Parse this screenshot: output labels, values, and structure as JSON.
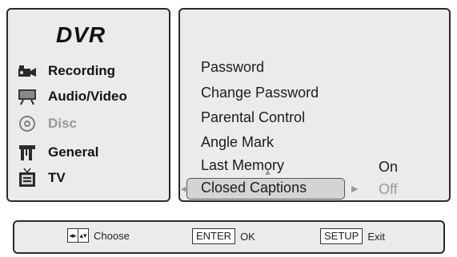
{
  "brand": "DVR",
  "sidebar": {
    "items": [
      {
        "label": "Recording",
        "icon": "camcorder-icon",
        "enabled": true
      },
      {
        "label": "Audio/Video",
        "icon": "monitor-icon",
        "enabled": true
      },
      {
        "label": "Disc",
        "icon": "disc-icon",
        "enabled": false
      },
      {
        "label": "General",
        "icon": "tools-icon",
        "enabled": true
      },
      {
        "label": "TV",
        "icon": "tv-icon",
        "enabled": true
      }
    ]
  },
  "menu": {
    "items": [
      {
        "label": "Password"
      },
      {
        "label": "Change Password"
      },
      {
        "label": "Parental Control"
      },
      {
        "label": "Angle Mark"
      },
      {
        "label": "Last Memory",
        "value": "On"
      },
      {
        "label": "Closed Captions",
        "value": "Off",
        "selected": true
      }
    ]
  },
  "footer": {
    "choose_label": "Choose",
    "ok_key": "ENTER",
    "ok_label": "OK",
    "exit_key": "SETUP",
    "exit_label": "Exit"
  },
  "colors": {
    "panel_bg": "#ebebeb",
    "border": "#2a2a2a",
    "dim_text": "#9a9a9a",
    "highlight_bg": "#d4d4d4"
  }
}
